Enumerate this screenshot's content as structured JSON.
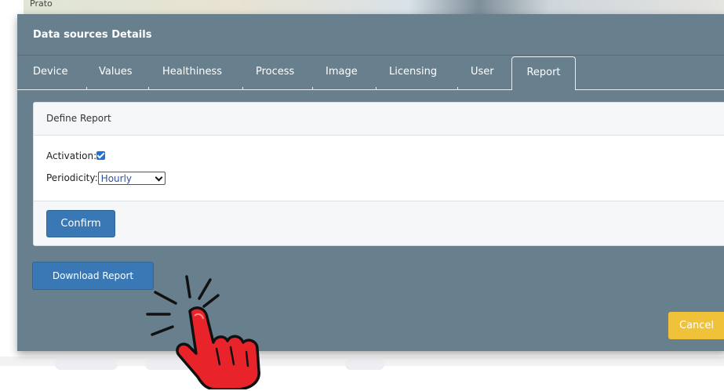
{
  "map_label": "Prato",
  "modal": {
    "title": "Data sources Details",
    "tabs": [
      {
        "label": "Device"
      },
      {
        "label": "Values"
      },
      {
        "label": "Healthiness"
      },
      {
        "label": "Process"
      },
      {
        "label": "Image"
      },
      {
        "label": "Licensing"
      },
      {
        "label": "User"
      },
      {
        "label": "Report",
        "active": true
      }
    ]
  },
  "report_card": {
    "header": "Define Report",
    "activation_label": "Activation:",
    "activation_checked": true,
    "periodicity_label": "Periodicity:",
    "periodicity_value": "Hourly",
    "confirm_label": "Confirm"
  },
  "download_label": "Download Report",
  "cancel_label": "Cancel",
  "colors": {
    "modal_bg": "#687f8e",
    "primary_button": "#3a78b5",
    "cancel_button": "#f0c23a",
    "cursor_red": "#e8232a"
  },
  "cursor_icon": "pointing-hand-click-icon"
}
